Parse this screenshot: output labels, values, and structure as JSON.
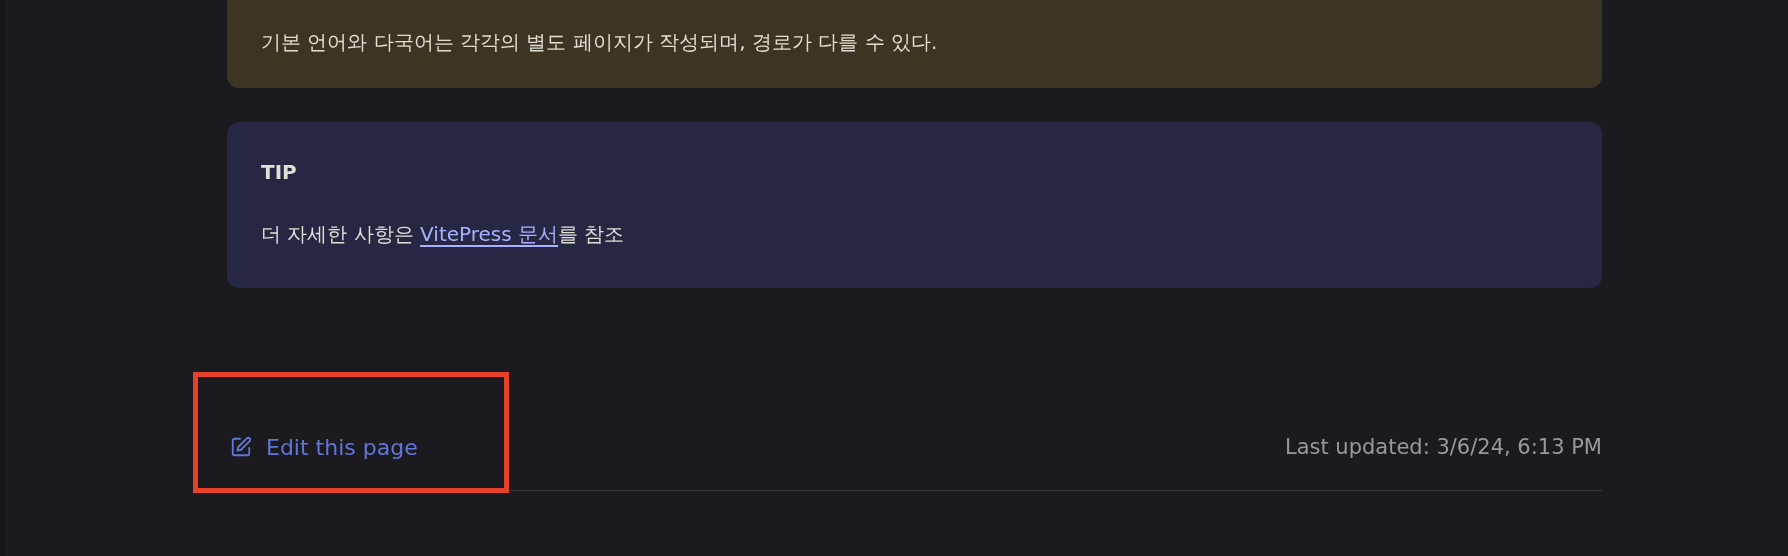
{
  "warning": {
    "text": "기본 언어와 다국어는 각각의 별도 페이지가 작성되며, 경로가 다를 수 있다."
  },
  "tip": {
    "title": "TIP",
    "before": "더 자세한 사항은 ",
    "link": "VitePress 문서",
    "after": "를 참조"
  },
  "footer": {
    "edit_link": "Edit this page",
    "highlighted": true,
    "last_updated": "Last updated: 3/6/24, 6:13 PM"
  }
}
